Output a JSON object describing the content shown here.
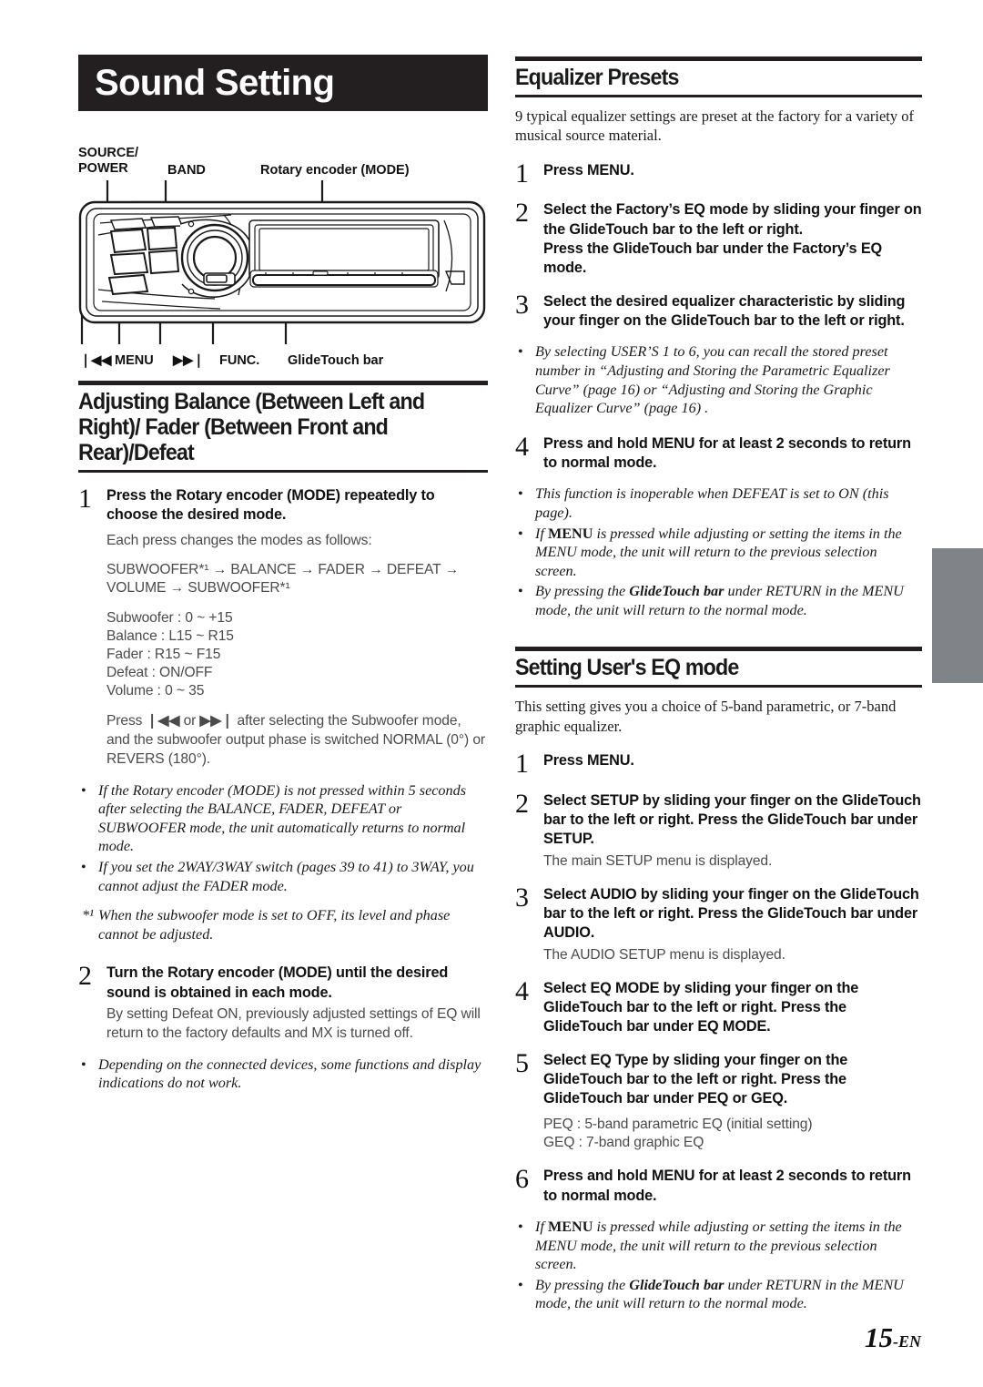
{
  "page": {
    "number_label": "15",
    "lang_suffix": "-EN"
  },
  "banner": {
    "title": "Sound Setting"
  },
  "diagram": {
    "callouts": {
      "source_power": "SOURCE/\nPOWER",
      "band": "BAND",
      "rotary_encoder": "Rotary encoder (MODE)"
    },
    "bottom_labels": {
      "prev": "❘◀◀",
      "menu": "MENU",
      "next": "▶▶❘",
      "func": "FUNC.",
      "glidetouch": "GlideTouch bar"
    }
  },
  "left_column": {
    "section": {
      "title": "Adjusting Balance (Between Left and Right)/ Fader (Between Front and Rear)/Defeat"
    },
    "step1": {
      "num": "1",
      "title_a": "Press the ",
      "title_b": "Rotary encoder (MODE)",
      "title_c": " repeatedly to choose the desired mode.",
      "sub": "Each press changes the modes as follows:",
      "flow": "SUBWOOFER*¹ → BALANCE → FADER → DEFEAT → VOLUME → SUBWOOFER*¹",
      "ranges": [
        "Subwoofer : 0 ~ +15",
        "Balance : L15 ~ R15",
        "Fader : R15 ~ F15",
        "Defeat : ON/OFF",
        "Volume : 0 ~ 35"
      ],
      "phase_note_a": "Press ",
      "phase_note_prev": "❘◀◀",
      "phase_note_b": " or ",
      "phase_note_next": "▶▶❘",
      "phase_note_c": " after selecting the Subwoofer mode, and the subwoofer output phase is switched NORMAL (0°) or REVERS (180°)."
    },
    "notes_1": [
      {
        "mark": "•",
        "text": "If the Rotary encoder (MODE) is not pressed within 5 seconds after selecting the BALANCE, FADER, DEFEAT or SUBWOOFER mode, the unit automatically returns to normal mode."
      },
      {
        "mark": "•",
        "text": "If you set the 2WAY/3WAY switch (pages 39 to 41) to 3WAY, you cannot adjust the FADER mode."
      }
    ],
    "footnote_1": {
      "mark": "*¹",
      "text": "When the subwoofer mode is set to OFF, its level and phase cannot be adjusted."
    },
    "step2": {
      "num": "2",
      "title_a": "Turn the ",
      "title_b": "Rotary encoder (MODE)",
      "title_c": " until the desired sound is obtained in each mode.",
      "sub": "By setting Defeat ON, previously adjusted settings of EQ will return to the factory defaults and MX is turned off."
    },
    "notes_2": [
      {
        "mark": "•",
        "text": "Depending on the connected devices, some functions and display indications do not work."
      }
    ]
  },
  "right_column": {
    "section_eq": {
      "title": "Equalizer Presets",
      "intro": "9 typical equalizer settings are preset at the factory for a variety of musical source material."
    },
    "eq_step1": {
      "num": "1",
      "title_a": "Press ",
      "title_b": "MENU",
      "title_c": "."
    },
    "eq_step2": {
      "num": "2",
      "p1a": "Select the Factory’s EQ mode by sliding your finger on the ",
      "p1b": "GlideTouch bar",
      "p1c": " to the left or right.",
      "p2a": "Press the ",
      "p2b": "GlideTouch bar",
      "p2c": " under the Factory’s EQ mode."
    },
    "eq_step3": {
      "num": "3",
      "t_a": "Select the desired equalizer characteristic by sliding your finger on the ",
      "t_b": "GlideTouch bar",
      "t_c": " to the left or right."
    },
    "eq_note_user": {
      "mark": "•",
      "text": "By selecting USER’S 1 to 6, you can recall the stored preset number in “Adjusting and Storing the Parametric Equalizer Curve” (page 16) or “Adjusting and Storing the Graphic Equalizer Curve” (page 16) ."
    },
    "eq_step4": {
      "num": "4",
      "t_a": "Press and hold ",
      "t_b": "MENU",
      "t_c": " for at least 2 seconds to return to normal mode."
    },
    "eq_notes": [
      {
        "mark": "•",
        "text": "This function is inoperable when DEFEAT is set to ON (this page)."
      },
      {
        "mark": "•",
        "pre": "If ",
        "bold": "MENU",
        "post": " is pressed while adjusting or setting the items in the MENU mode, the unit will return to the previous selection screen."
      },
      {
        "mark": "•",
        "pre": "By pressing the ",
        "bold": "GlideTouch bar",
        "post": " under RETURN in the MENU mode, the unit will return to the normal mode."
      }
    ],
    "section_user_eq": {
      "title": "Setting User's EQ mode",
      "intro": "This setting gives you a choice of 5-band parametric, or 7-band graphic equalizer."
    },
    "ueq_step1": {
      "num": "1",
      "title_a": "Press ",
      "title_b": "MENU",
      "title_c": "."
    },
    "ueq_step2": {
      "num": "2",
      "a": "Select SETUP by sliding your finger on the ",
      "b1": "GlideTouch bar",
      "c": " to the left or right. Press the ",
      "b2": "GlideTouch bar",
      "d": " under SETUP.",
      "sub": "The main SETUP menu is displayed."
    },
    "ueq_step3": {
      "num": "3",
      "a": "Select AUDIO by sliding your finger on the ",
      "b1": "GlideTouch bar",
      "c": " to the left or right. Press the ",
      "b2": "GlideTouch bar",
      "d": " under AUDIO.",
      "sub": "The AUDIO SETUP menu is displayed."
    },
    "ueq_step4": {
      "num": "4",
      "a": "Select EQ MODE by sliding your finger on the ",
      "b1": "GlideTouch bar",
      "c": " to the left or right. Press the ",
      "b2": "GlideTouch bar",
      "d": " under EQ MODE."
    },
    "ueq_step5": {
      "num": "5",
      "a": "Select EQ Type by sliding your finger on the ",
      "b1": "GlideTouch bar",
      "c": " to the left or right. Press the ",
      "b2": "GlideTouch bar",
      "d": " under PEQ or GEQ.",
      "peq": "PEQ : 5-band parametric EQ (initial setting)",
      "geq": "GEQ : 7-band graphic EQ"
    },
    "ueq_step6": {
      "num": "6",
      "t_a": "Press and hold ",
      "t_b": "MENU",
      "t_c": " for at least 2 seconds to return to normal mode."
    },
    "ueq_notes": [
      {
        "mark": "•",
        "pre": "If ",
        "bold": "MENU",
        "post": " is pressed while adjusting or setting the items in the MENU mode, the unit will return to the previous selection screen."
      },
      {
        "mark": "•",
        "pre": "By pressing the ",
        "bold": "GlideTouch bar",
        "post": " under RETURN in the MENU mode, the unit will return to the normal mode."
      }
    ]
  }
}
